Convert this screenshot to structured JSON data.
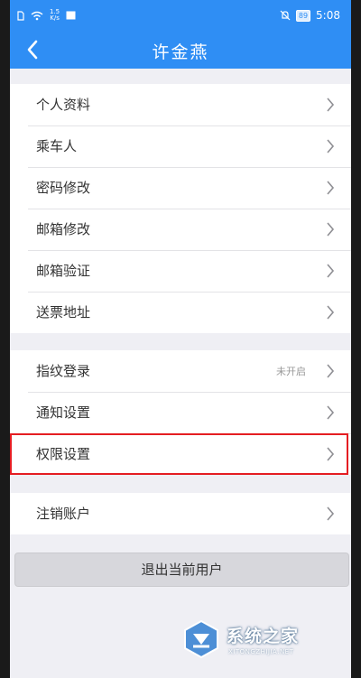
{
  "status_bar": {
    "net_speed_top": "1.5",
    "net_speed_bottom": "K/s",
    "battery": "89",
    "time": "5:08"
  },
  "header": {
    "title": "许金燕"
  },
  "groups": [
    {
      "items": [
        {
          "label": "个人资料"
        },
        {
          "label": "乘车人"
        },
        {
          "label": "密码修改"
        },
        {
          "label": "邮箱修改"
        },
        {
          "label": "邮箱验证"
        },
        {
          "label": "送票地址"
        }
      ]
    },
    {
      "items": [
        {
          "label": "指纹登录",
          "status": "未开启"
        },
        {
          "label": "通知设置"
        },
        {
          "label": "权限设置",
          "highlighted": true
        }
      ]
    },
    {
      "items": [
        {
          "label": "注销账户"
        }
      ]
    }
  ],
  "logout_button": {
    "label": "退出当前用户"
  },
  "watermark": {
    "text": "系统之家",
    "sub": "XITONGZHIJIA.NET"
  },
  "colors": {
    "header": "#2f8ef4",
    "background": "#efeff4",
    "highlight": "#e41d22"
  },
  "icons": [
    "sim-icon",
    "wifi-icon",
    "image-icon",
    "mute-icon",
    "battery-icon",
    "back-arrow-icon",
    "chevron-right-icon"
  ]
}
